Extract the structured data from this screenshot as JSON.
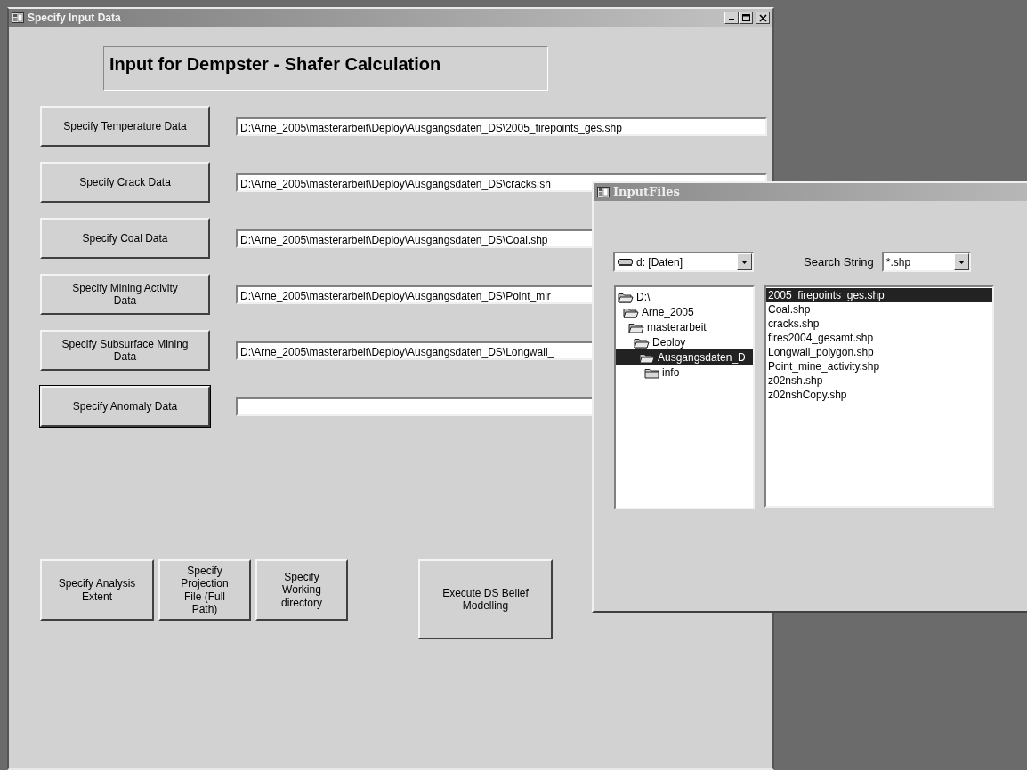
{
  "window": {
    "title": "Specify Input Data",
    "heading": "Input for Dempster - Shafer Calculation"
  },
  "inputs": [
    {
      "button": "Specify Temperature Data",
      "value": "D:\\Arne_2005\\masterarbeit\\Deploy\\Ausgangsdaten_DS\\2005_firepoints_ges.shp",
      "focused": false
    },
    {
      "button": "Specify Crack Data",
      "value": "D:\\Arne_2005\\masterarbeit\\Deploy\\Ausgangsdaten_DS\\cracks.sh",
      "focused": false
    },
    {
      "button": "Specify Coal Data",
      "value": "D:\\Arne_2005\\masterarbeit\\Deploy\\Ausgangsdaten_DS\\Coal.shp",
      "focused": false
    },
    {
      "button": "Specify Mining Activity Data",
      "value": "D:\\Arne_2005\\masterarbeit\\Deploy\\Ausgangsdaten_DS\\Point_mir",
      "focused": false
    },
    {
      "button": "Specify Subsurface Mining Data",
      "value": "D:\\Arne_2005\\masterarbeit\\Deploy\\Ausgangsdaten_DS\\Longwall_",
      "focused": false
    },
    {
      "button": "Specify Anomaly Data",
      "focused": true
    }
  ],
  "action_buttons": [
    {
      "label": "Specify Analysis Extent",
      "kind": "wide"
    },
    {
      "label": "Specify Projection File (Full Path)",
      "kind": "narrow"
    },
    {
      "label": "Specify Working directory",
      "kind": "narrow"
    },
    {
      "label": "Execute DS Belief Modelling",
      "kind": "large"
    }
  ],
  "dialog": {
    "title": "InputFiles",
    "drive": "d: [Daten]",
    "search_label": "Search String",
    "search_value": "*.shp",
    "folders": [
      {
        "name": "D:\\",
        "expanded": true,
        "selected": false,
        "children": [
          {
            "name": "Arne_2005",
            "expanded": true,
            "selected": false,
            "children": [
              {
                "name": "masterarbeit",
                "expanded": true,
                "selected": false,
                "children": [
                  {
                    "name": "Deploy",
                    "expanded": true,
                    "selected": false,
                    "children": [
                      {
                        "name": "Ausgangsdaten_D",
                        "expanded": true,
                        "selected": true,
                        "children": [
                          {
                            "name": "info",
                            "expanded": false,
                            "selected": false
                          }
                        ]
                      }
                    ]
                  }
                ]
              }
            ]
          }
        ]
      }
    ],
    "files": [
      {
        "name": "2005_firepoints_ges.shp",
        "selected": true
      },
      {
        "name": "Coal.shp",
        "selected": false
      },
      {
        "name": "cracks.shp",
        "selected": false
      },
      {
        "name": "fires2004_gesamt.shp",
        "selected": false
      },
      {
        "name": "Longwall_polygon.shp",
        "selected": false
      },
      {
        "name": "Point_mine_activity.shp",
        "selected": false
      },
      {
        "name": "z02nsh.shp",
        "selected": false
      },
      {
        "name": "z02nshCopy.shp",
        "selected": false
      }
    ]
  }
}
